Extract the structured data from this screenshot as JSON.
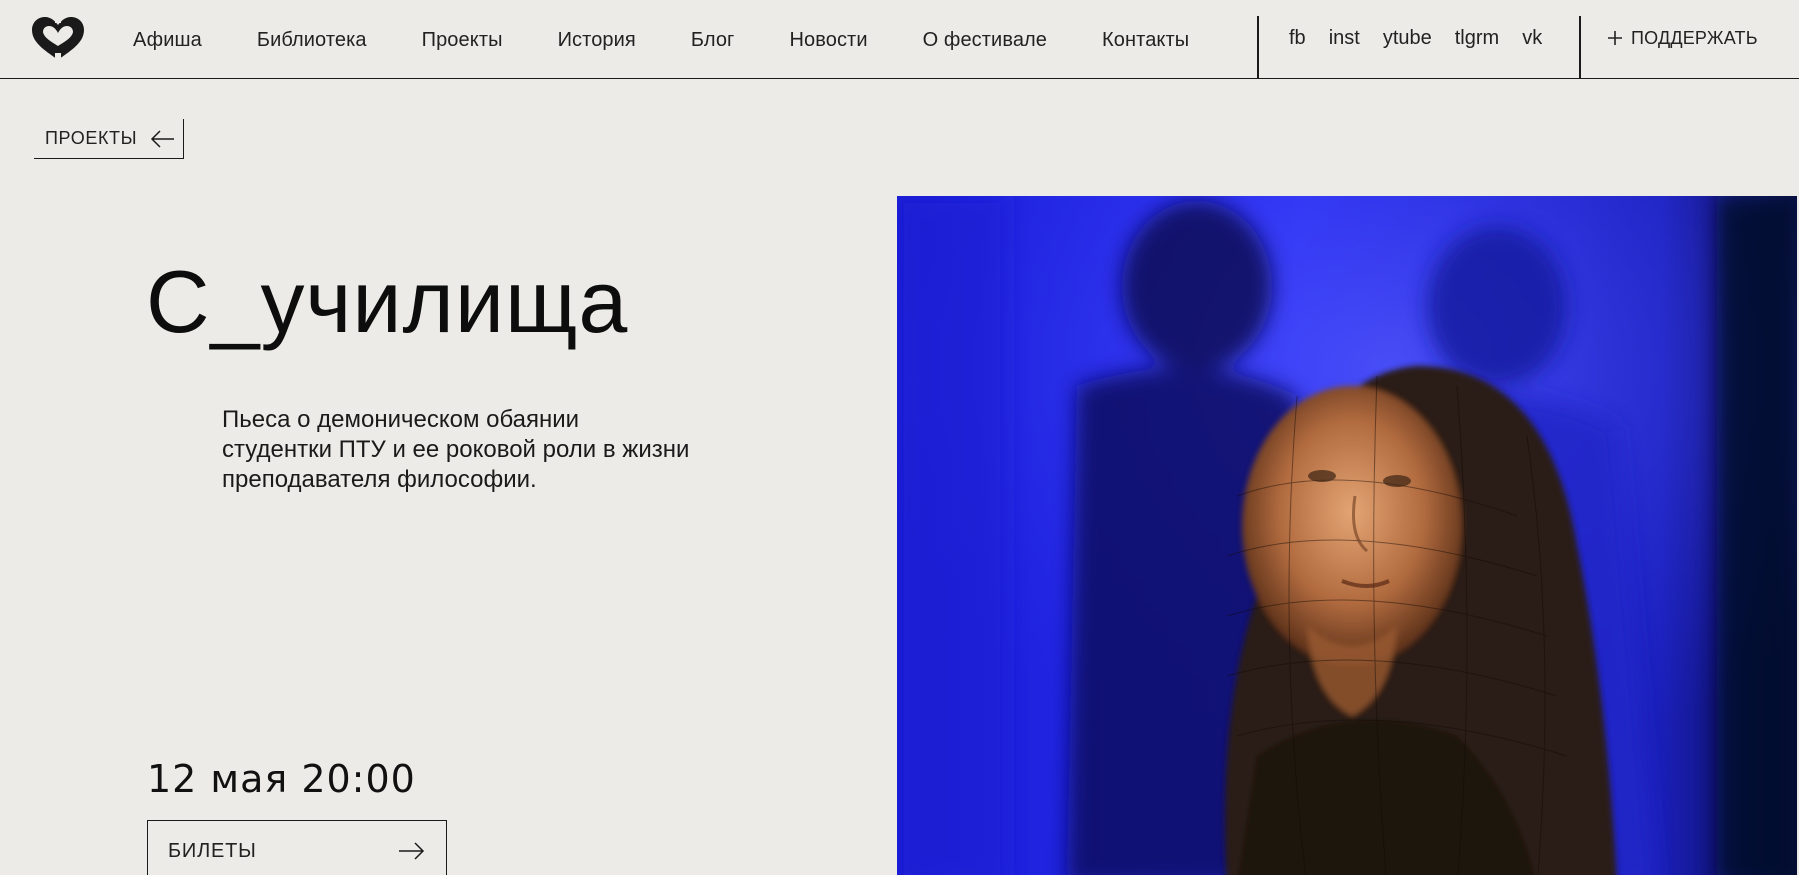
{
  "header": {
    "logo_icon": "heart-logo-icon",
    "nav": [
      {
        "label": "Афиша"
      },
      {
        "label": "Библиотека"
      },
      {
        "label": "Проекты"
      },
      {
        "label": "История"
      },
      {
        "label": "Блог"
      },
      {
        "label": "Новости"
      },
      {
        "label": "О фестивале"
      },
      {
        "label": "Контакты"
      }
    ],
    "social": [
      {
        "label": "fb"
      },
      {
        "label": "inst"
      },
      {
        "label": "ytube"
      },
      {
        "label": "tlgrm"
      },
      {
        "label": "vk"
      }
    ],
    "support": {
      "icon": "plus-icon",
      "label": "ПОДДЕРЖАТЬ"
    }
  },
  "breadcrumb": {
    "label": "ПРОЕКТЫ",
    "icon": "arrow-left-icon"
  },
  "project": {
    "title": "С_училища",
    "description": "Пьеса о демоническом обаянии студентки ПТУ и ее роковой роли в жизни преподавателя философии.",
    "datetime": "12 мая 20:00",
    "tickets_label": "БИЛЕТЫ",
    "tickets_icon": "arrow-right-icon"
  },
  "colors": {
    "background": "#ecebe7",
    "text": "#1a1a1a",
    "photo_blue": "#1216b8",
    "photo_warm": "#c9875a"
  }
}
